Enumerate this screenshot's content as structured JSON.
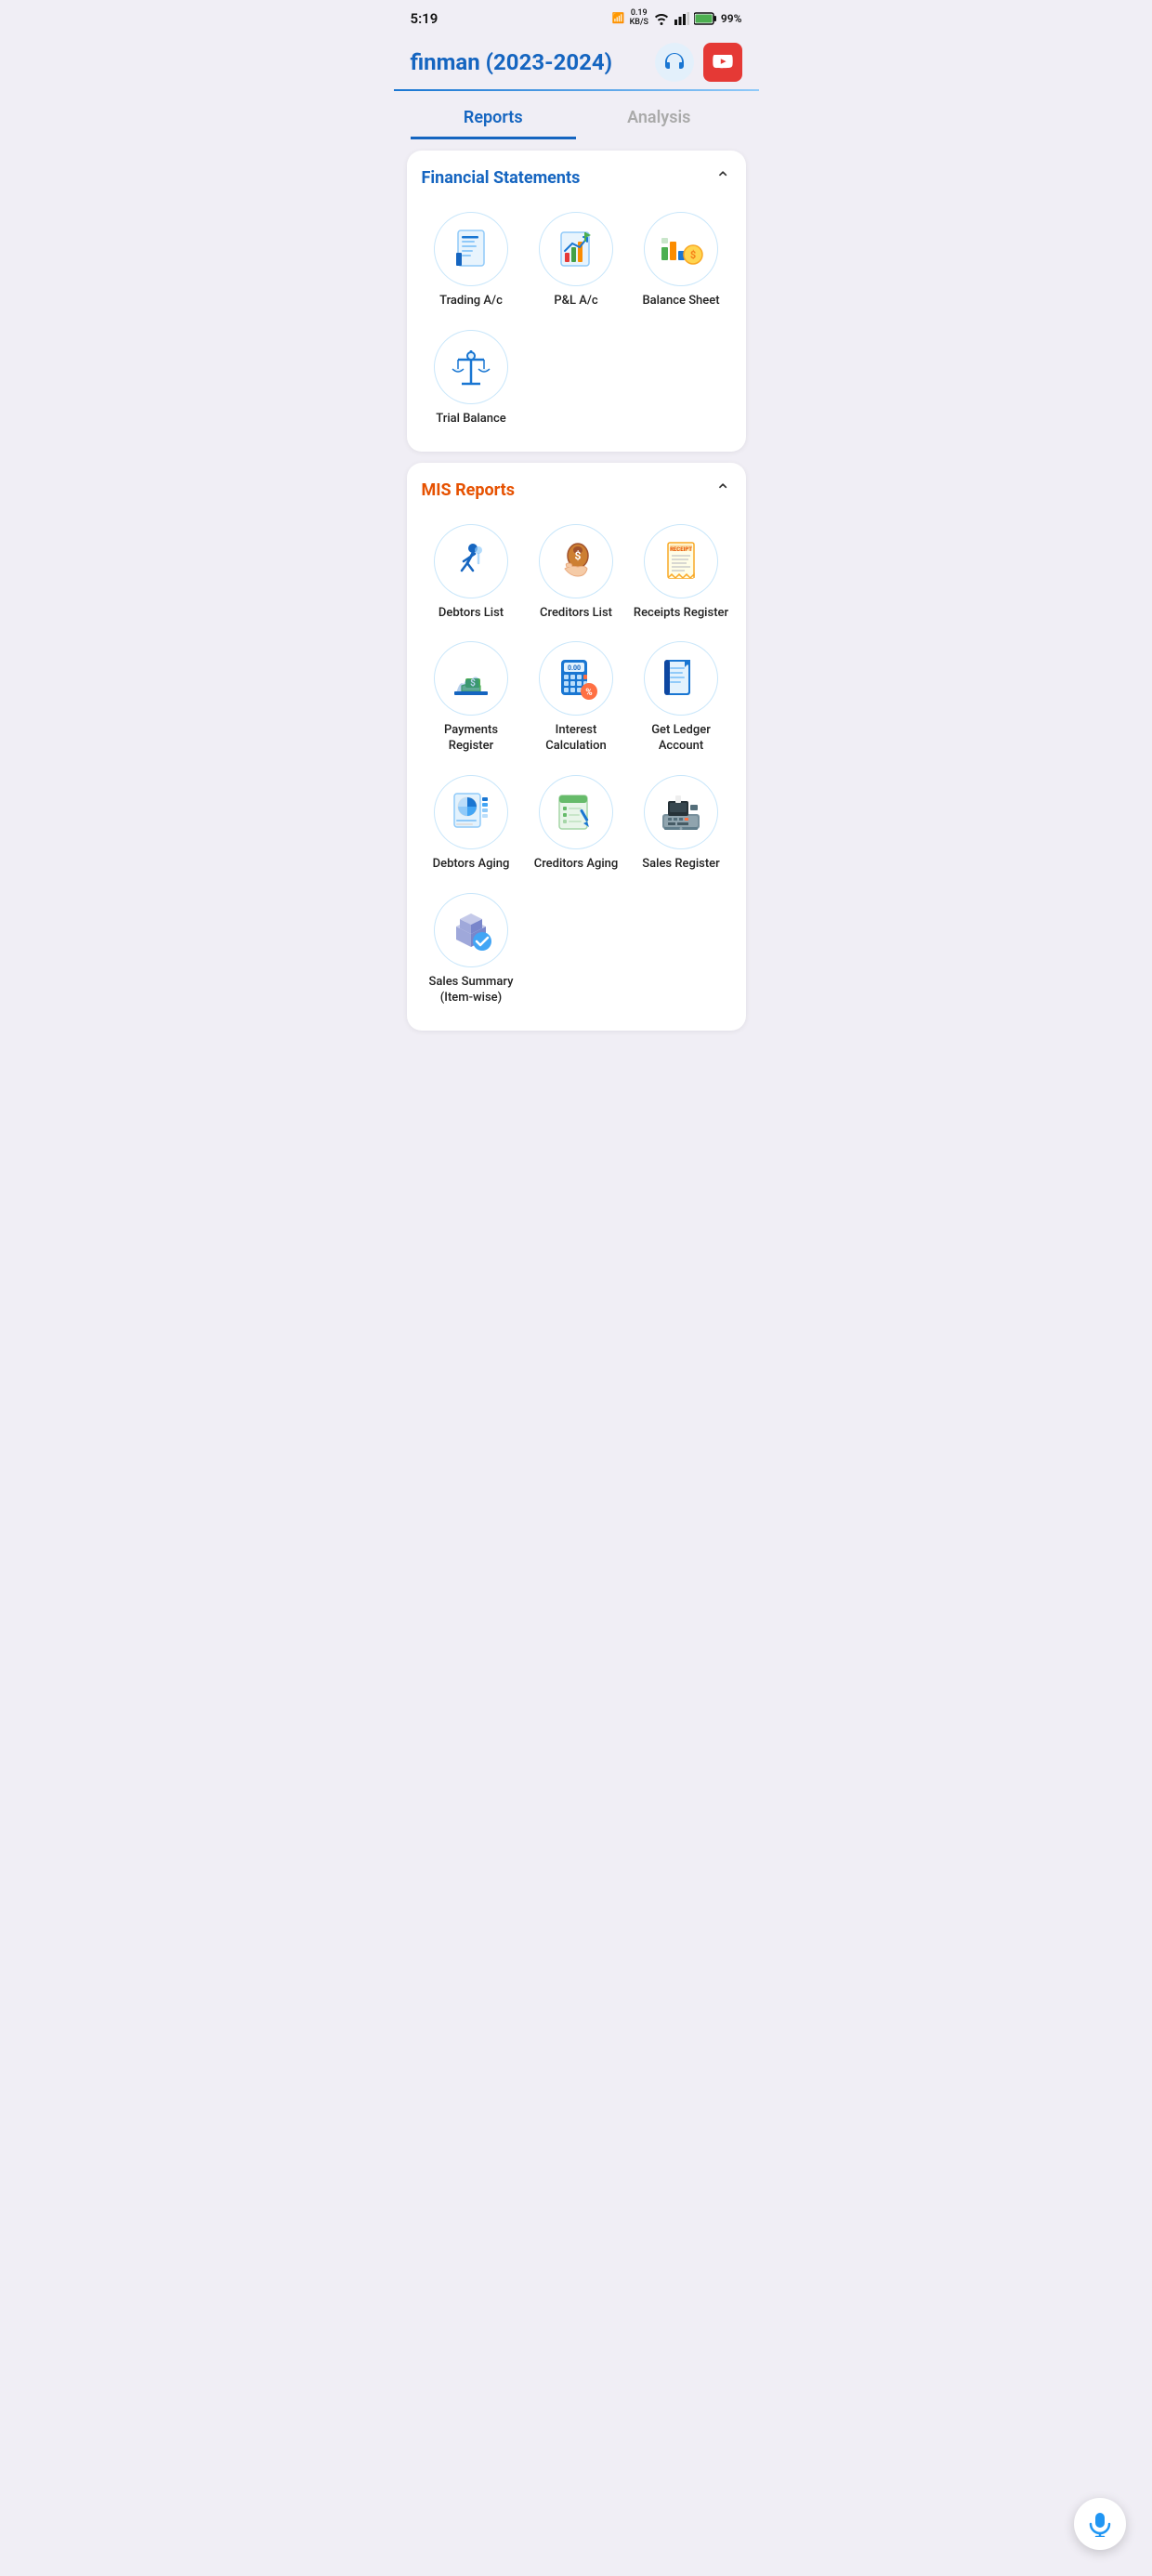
{
  "statusBar": {
    "time": "5:19",
    "battery": "99%",
    "signal": "●●●",
    "wifi": "wifi",
    "speed": "0.19\nKB/S"
  },
  "header": {
    "title": "finman ",
    "titleHighlight": "(2023-2024)",
    "headsetAlt": "Support",
    "youtubeAlt": "YouTube"
  },
  "tabs": [
    {
      "label": "Reports",
      "active": true
    },
    {
      "label": "Analysis",
      "active": false
    }
  ],
  "financialStatements": {
    "title": "Financial Statements",
    "items": [
      {
        "label": "Trading A/c",
        "icon": "trading"
      },
      {
        "label": "P&L A/c",
        "icon": "pnl"
      },
      {
        "label": "Balance Sheet",
        "icon": "balance-sheet"
      },
      {
        "label": "Trial Balance",
        "icon": "trial-balance"
      }
    ]
  },
  "misReports": {
    "title": "MIS Reports",
    "items": [
      {
        "label": "Debtors List",
        "icon": "debtors-list"
      },
      {
        "label": "Creditors List",
        "icon": "creditors-list"
      },
      {
        "label": "Receipts Register",
        "icon": "receipts-register"
      },
      {
        "label": "Payments Register",
        "icon": "payments-register"
      },
      {
        "label": "Interest Calculation",
        "icon": "interest-calc"
      },
      {
        "label": "Get Ledger Account",
        "icon": "ledger-account"
      },
      {
        "label": "Debtors Aging",
        "icon": "debtors-aging"
      },
      {
        "label": "Creditors Aging",
        "icon": "creditors-aging"
      },
      {
        "label": "Sales Register",
        "icon": "sales-register"
      },
      {
        "label": "Sales Summary (Item-wise)",
        "icon": "sales-summary"
      }
    ]
  }
}
